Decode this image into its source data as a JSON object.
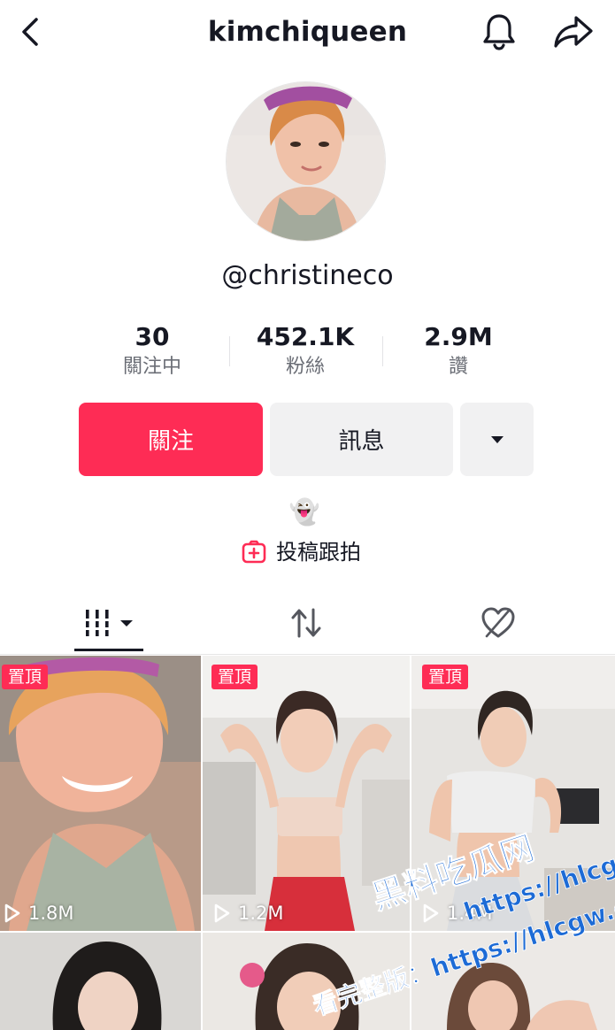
{
  "header": {
    "title": "kimchiqueen",
    "back_icon": "chevron-left-icon",
    "bell_icon": "bell-icon",
    "share_icon": "share-arrow-icon"
  },
  "profile": {
    "handle": "@christineco",
    "bio_emoji": "👻"
  },
  "stats": [
    {
      "value": "30",
      "label": "關注中"
    },
    {
      "value": "452.1K",
      "label": "粉絲"
    },
    {
      "value": "2.9M",
      "label": "讚"
    }
  ],
  "actions": {
    "follow_label": "關注",
    "message_label": "訊息",
    "dropdown_icon": "caret-down-icon"
  },
  "duet": {
    "label": "投稿跟拍",
    "icon": "plus-square-icon"
  },
  "tabs": [
    {
      "name": "videos",
      "icon": "grid-icon",
      "active": true
    },
    {
      "name": "reposts",
      "icon": "repost-icon",
      "active": false
    },
    {
      "name": "liked",
      "icon": "heart-lock-icon",
      "active": false
    }
  ],
  "videos": [
    {
      "pinned_label": "置頂",
      "views": "1.8M"
    },
    {
      "pinned_label": "置頂",
      "views": "1.2M"
    },
    {
      "pinned_label": "置頂",
      "views": "1.4M"
    },
    {
      "views": ""
    },
    {
      "views": ""
    },
    {
      "views": ""
    }
  ],
  "watermark": {
    "title": "黑料吃瓜网",
    "url_a": "https://hlcgw.co",
    "url_b": "看完整版：https://hlcgw.co"
  },
  "colors": {
    "accent": "#fe2c55",
    "secondary_button": "#f1f1f2",
    "text": "#161823",
    "muted": "#6b6e76"
  }
}
